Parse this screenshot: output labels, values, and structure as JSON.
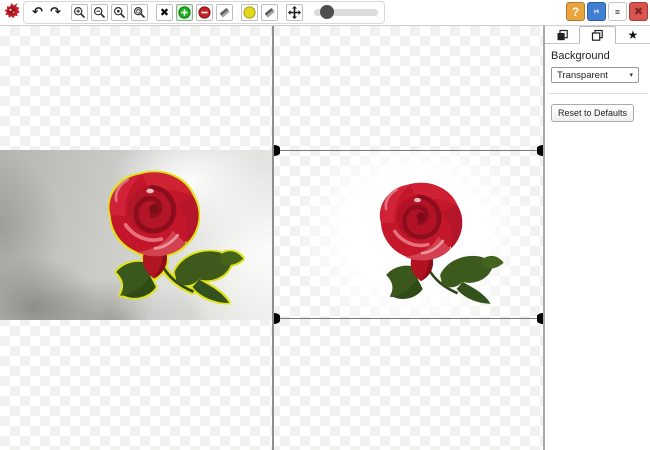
{
  "app": {
    "logo_icon": "red-flower-logo",
    "window_controls": {
      "help_glyph": "?",
      "save_icon": "floppy-save-icon",
      "menu_icon": "hamburger-menu-icon",
      "close_glyph": "✖"
    }
  },
  "toolbar": {
    "undo_glyph": "↶",
    "redo_glyph": "↷",
    "clear_glyph": "✖",
    "icons": {
      "zoom_in": "magnifier-plus-icon",
      "zoom_out": "magnifier-minus-icon",
      "zoom_actual": "magnifier-actual-size-icon",
      "zoom_reset": "magnifier-reset-icon",
      "foreground_marker": "green-plus-marker-icon",
      "background_marker": "red-minus-marker-icon",
      "eraser_foreground": "eraser-icon",
      "hair_marker": "yellow-marker-icon",
      "eraser_hair": "eraser-icon",
      "pan_tool": "move-arrows-icon"
    },
    "active_tool": "foreground_marker",
    "brush_slider": {
      "value_percent": 18
    }
  },
  "panel": {
    "tabs": [
      {
        "id": "layers-filled-tab",
        "icon": "layers-filled-icon",
        "active": false
      },
      {
        "id": "layers-outline-tab",
        "icon": "layers-outline-icon",
        "active": true
      },
      {
        "id": "favorites-tab",
        "icon": "star-icon",
        "active": false
      }
    ],
    "star_glyph": "★",
    "background": {
      "label": "Background",
      "selected": "Transparent",
      "arrow_glyph": "▾"
    },
    "reset_label": "Reset to Defaults"
  },
  "canvas": {
    "left_view": "original image with yellow selection outline around red rose",
    "right_view": "cut-out rose result on transparent/white background",
    "selection_outline_color": "#dfe414",
    "colors": {
      "checker_light": "#f1f1f0",
      "divider_gray": "#8f8f8f",
      "marker_green": "#1db31d",
      "marker_red": "#c42222",
      "marker_yellow": "#e3d91c",
      "help_orange": "#e9a43e",
      "save_blue": "#3f7fd4",
      "close_red": "#d9534f"
    }
  }
}
